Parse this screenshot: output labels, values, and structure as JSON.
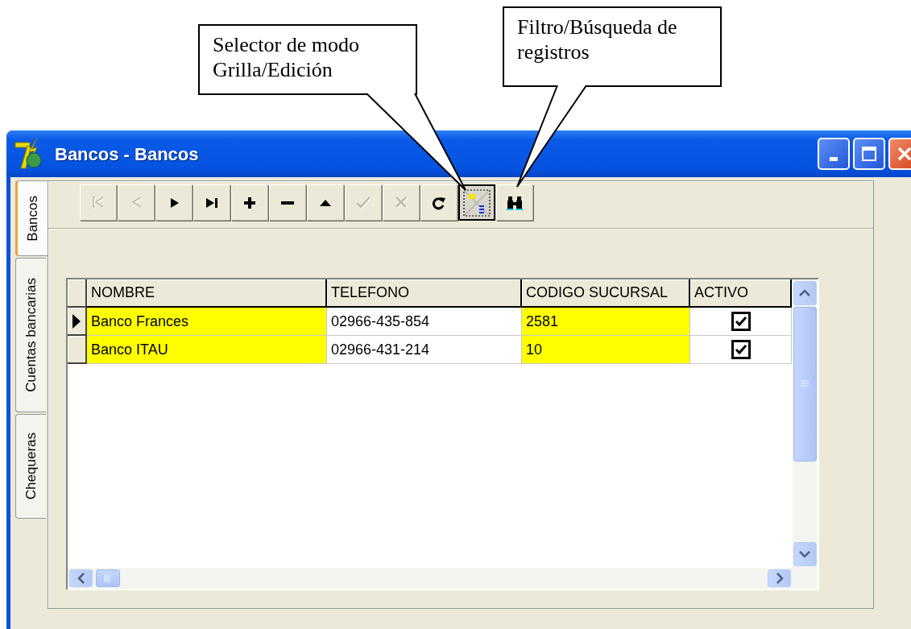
{
  "callouts": [
    {
      "text": "Selector de modo Grilla/Edición"
    },
    {
      "text": "Filtro/Búsqueda de registros"
    }
  ],
  "window": {
    "title": "Bancos - Bancos"
  },
  "tabs": [
    {
      "label": "Bancos",
      "selected": true
    },
    {
      "label": "Cuentas bancarias",
      "selected": false
    },
    {
      "label": "Chequeras",
      "selected": false
    }
  ],
  "toolbar": [
    {
      "kind": "first",
      "disabled": true,
      "pressed": false
    },
    {
      "kind": "prior",
      "disabled": true,
      "pressed": false
    },
    {
      "kind": "next",
      "disabled": false,
      "pressed": false
    },
    {
      "kind": "last",
      "disabled": false,
      "pressed": false
    },
    {
      "kind": "insert",
      "disabled": false,
      "pressed": false
    },
    {
      "kind": "delete",
      "disabled": false,
      "pressed": false
    },
    {
      "kind": "edit",
      "disabled": false,
      "pressed": false
    },
    {
      "kind": "post",
      "disabled": true,
      "pressed": false
    },
    {
      "kind": "cancel",
      "disabled": true,
      "pressed": false
    },
    {
      "kind": "refresh",
      "disabled": false,
      "pressed": false
    },
    {
      "kind": "mode",
      "disabled": false,
      "pressed": true
    },
    {
      "kind": "find",
      "disabled": false,
      "pressed": false
    }
  ],
  "table": {
    "columns": [
      {
        "label": "NOMBRE",
        "highlighted": true
      },
      {
        "label": "TELEFONO",
        "highlighted": false
      },
      {
        "label": "CODIGO SUCURSAL",
        "highlighted": true
      },
      {
        "label": "ACTIVO",
        "highlighted": false
      }
    ],
    "rows": [
      {
        "current": true,
        "cells": [
          "Banco Frances",
          "02966-435-854",
          "2581"
        ],
        "activo": true
      },
      {
        "current": false,
        "cells": [
          "Banco ITAU",
          "02966-431-214",
          "10"
        ],
        "activo": true
      }
    ]
  }
}
